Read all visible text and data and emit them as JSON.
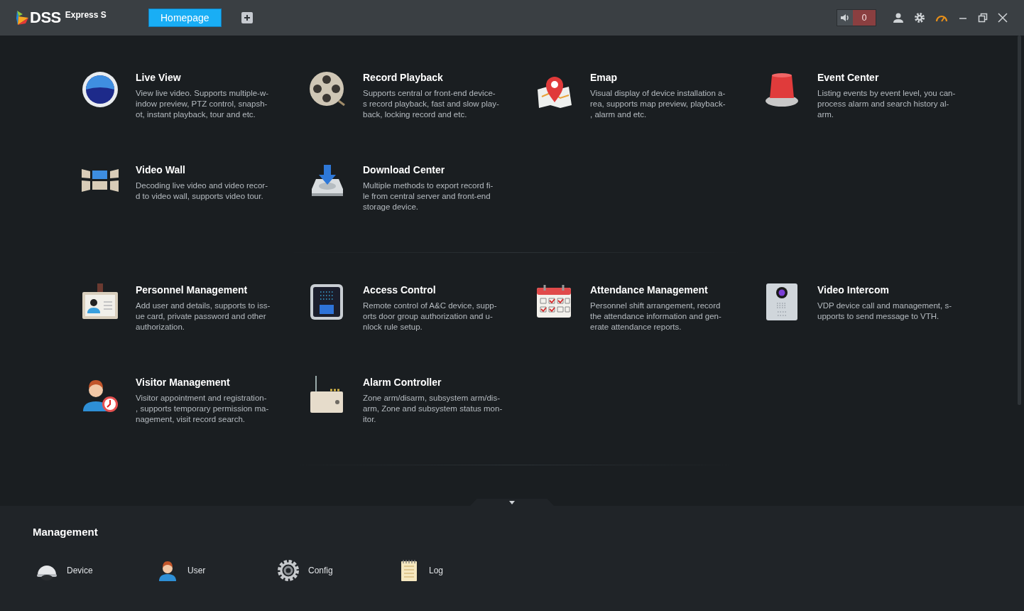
{
  "app": {
    "logo_text": "DSS",
    "edition": "Express S"
  },
  "tabs": [
    {
      "label": "Homepage",
      "selected": true
    }
  ],
  "alarm_count": "0",
  "module_groups": [
    [
      {
        "kind": "live",
        "title": "Live View",
        "lines": [
          "View live video. Supports multiple-w-",
          "indow preview, PTZ control, snapsh-",
          "ot, instant playback, tour and etc."
        ]
      },
      {
        "kind": "playback",
        "title": "Record Playback",
        "lines": [
          "Supports central or front-end device-",
          "s record playback, fast and slow play-",
          "back, locking record and etc."
        ]
      },
      {
        "kind": "emap",
        "title": "Emap",
        "lines": [
          "Visual display of device installation a-",
          "rea, supports map preview, playback-",
          ", alarm and etc."
        ]
      },
      {
        "kind": "event",
        "title": "Event Center",
        "lines": [
          "Listing events by event level, you can-",
          " process alarm and search history al-",
          "arm."
        ]
      },
      {
        "kind": "wall",
        "title": "Video Wall",
        "lines": [
          "Decoding live video and video recor-",
          "d to video wall, supports video tour."
        ]
      },
      {
        "kind": "download",
        "title": "Download Center",
        "lines": [
          "Multiple methods to export record fi-",
          "le from central server and front-end",
          "storage device."
        ]
      }
    ],
    [
      {
        "kind": "personnel",
        "title": "Personnel Management",
        "lines": [
          "Add user and details, supports to iss-",
          "ue card, private password and other",
          "authorization."
        ]
      },
      {
        "kind": "access",
        "title": "Access Control",
        "lines": [
          "Remote control of A&C device, supp-",
          "orts door group authorization and u-",
          "nlock rule setup."
        ]
      },
      {
        "kind": "attendance",
        "title": "Attendance Management",
        "lines": [
          "Personnel shift arrangement, record",
          "the attendance information and gen-",
          "erate attendance reports."
        ]
      },
      {
        "kind": "intercom",
        "title": "Video Intercom",
        "lines": [
          "VDP device call and management, s-",
          "upports to send message to VTH."
        ]
      },
      {
        "kind": "visitor",
        "title": "Visitor Management",
        "lines": [
          "Visitor appointment and registration-",
          ", supports temporary permission ma-",
          "nagement, visit record search."
        ]
      },
      {
        "kind": "alarm",
        "title": "Alarm Controller",
        "lines": [
          "Zone arm/disarm, subsystem arm/dis-",
          "arm, Zone and subsystem status mon-",
          "itor."
        ]
      }
    ]
  ],
  "management": {
    "title": "Management",
    "items": [
      {
        "kind": "device",
        "label": "Device"
      },
      {
        "kind": "user",
        "label": "User"
      },
      {
        "kind": "config",
        "label": "Config"
      },
      {
        "kind": "log",
        "label": "Log"
      }
    ]
  }
}
